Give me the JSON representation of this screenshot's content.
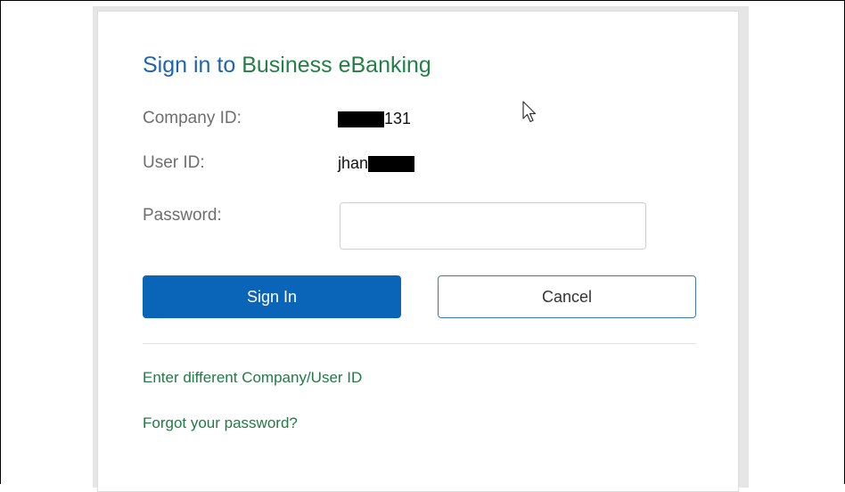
{
  "title": {
    "part_a": "Sign in to",
    "part_b": "Business eBanking"
  },
  "company": {
    "label": "Company ID:",
    "value_suffix": "131"
  },
  "user": {
    "label": "User ID:",
    "value_prefix": "jhan"
  },
  "password": {
    "label": "Password:",
    "value": "",
    "placeholder": ""
  },
  "buttons": {
    "sign_in": "Sign In",
    "cancel": "Cancel"
  },
  "links": {
    "different_id": "Enter different Company/User ID",
    "forgot": "Forgot your password?"
  },
  "colors": {
    "title_blue": "#1f63b0",
    "title_green": "#228046",
    "primary_button": "#0a64b8",
    "link_green": "#227a45"
  },
  "icons": {
    "cursor": "mouse-pointer-icon"
  }
}
